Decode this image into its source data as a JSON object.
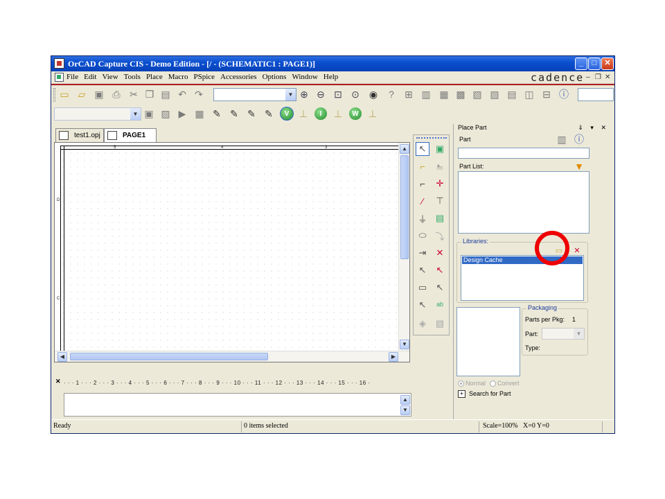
{
  "window": {
    "title": "OrCAD Capture CIS - Demo Edition - [/ - (SCHEMATIC1 : PAGE1)]",
    "brand": "cadence"
  },
  "menu": [
    "File",
    "Edit",
    "View",
    "Tools",
    "Place",
    "Macro",
    "PSpice",
    "Accessories",
    "Options",
    "Window",
    "Help"
  ],
  "toolbar": {
    "search_value": "",
    "part_combo_value": ""
  },
  "tabs": [
    {
      "label": "test1.opj",
      "active": false
    },
    {
      "label": "PAGE1",
      "active": true
    }
  ],
  "canvas": {
    "top_zone_labels": [
      "5",
      "4",
      "3"
    ],
    "left_zone_labels": [
      "D",
      "C"
    ]
  },
  "place_part": {
    "header": "Place Part",
    "part_label": "Part",
    "part_value": "",
    "part_list_label": "Part List:",
    "libraries_label": "Libraries:",
    "libraries": [
      "Design Cache"
    ],
    "packaging_label": "Packaging",
    "parts_per_pkg_label": "Parts per Pkg:",
    "parts_per_pkg_value": "1",
    "part_label2": "Part:",
    "type_label": "Type:",
    "normal_label": "Normal",
    "convert_label": "Convert",
    "search_label": "Search for Part"
  },
  "session_log": {
    "ruler": "· · · 1 · · · 2 · · · 3 · · · 4 · · · 5 · · · 6 · · · 7 · · · 8 · · · 9 · · · 10 · · · 11 · · · 12 · · · 13 · · · 14 · · · 15 · · · 16 ·"
  },
  "status": {
    "ready": "Ready",
    "selected": "0 items selected",
    "scale": "Scale=100%",
    "coords": "X=0  Y=0"
  },
  "colors": {
    "titlebar": "#0a4fd0",
    "highlight_circle": "#ee0000",
    "selection": "#316ac5",
    "accent_red": "#b02020"
  },
  "icons": [
    "new-icon",
    "open-icon",
    "save-icon",
    "print-icon",
    "cut-icon",
    "copy-icon",
    "paste-icon",
    "undo-icon",
    "redo-icon",
    "zoom-in-icon",
    "zoom-out-icon",
    "zoom-area-icon",
    "zoom-all-icon",
    "eye-icon",
    "help-icon",
    "new-library-icon",
    "delete-library-icon",
    "filter-icon"
  ]
}
